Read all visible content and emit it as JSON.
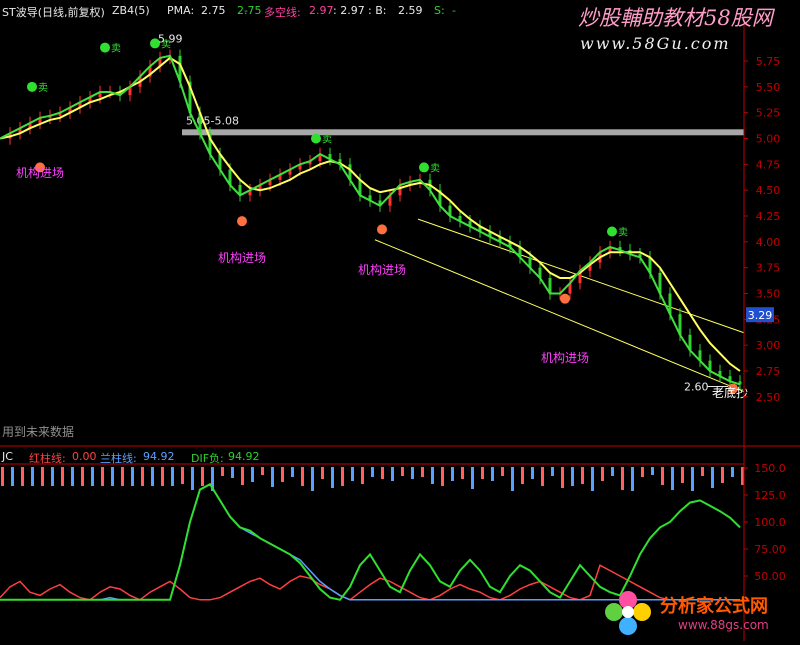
{
  "header": {
    "name": "ST波导(日线,前复权)",
    "indicator": "ZB4(5)",
    "pma_label": "PMA:",
    "pma_value": "2.75",
    "dash": "-",
    "pma2_value": "2.75",
    "multi_label": "多空线:",
    "multi_value": "2.97",
    "colon_value": ": 2.97",
    "b_label": ": B:",
    "b_value": "2.59",
    "s_label": "S:",
    "s_value": "-"
  },
  "sub_header": {
    "name": "JC",
    "red_label": "红柱线:",
    "red_value": "0.00",
    "blue_label": "兰柱线:",
    "blue_value": "94.92",
    "dif_label": "DIF负:",
    "dif_value": "94.92"
  },
  "annotations": {
    "high_price": "5.99",
    "range_label": "5.05-5.08",
    "low_price": "2.60",
    "future_note": "用到未来数据",
    "buy_signal": "机构进场",
    "bottom_signal": "老底抄",
    "sell_mark": "卖",
    "current_price": "3.29"
  },
  "watermark": {
    "title": "炒股輔助教材58股网",
    "url": "www.58Gu.com",
    "logo_title": "分析家公式网",
    "logo_url": "www.88gs.com"
  },
  "colors": {
    "up": "#ff3030",
    "down": "#30d030",
    "ma": "#ffff60",
    "green_line": "#40e040",
    "axis": "#c00000"
  },
  "chart_data": [
    {
      "type": "line",
      "title": "ST波导(日线,前复权)",
      "xlabel": "",
      "ylabel": "",
      "ylim": [
        2.35,
        5.95
      ],
      "y_ticks": [
        "2.50",
        "2.75",
        "3.00",
        "3.25",
        "3.50",
        "3.75",
        "4.00",
        "4.25",
        "4.50",
        "4.75",
        "5.00",
        "5.25",
        "5.50",
        "5.75"
      ],
      "x": [
        0,
        10,
        20,
        30,
        40,
        50,
        60,
        70,
        80,
        90,
        100,
        110,
        120,
        130,
        140,
        150,
        160,
        170,
        180,
        190,
        200,
        210,
        220,
        230,
        240,
        250,
        260,
        270,
        280,
        290,
        300,
        310,
        320,
        330,
        340,
        350,
        360,
        370,
        380,
        390,
        400,
        410,
        420,
        430,
        440,
        450,
        460,
        470,
        480,
        490,
        500,
        510,
        520,
        530,
        540,
        550,
        560,
        570,
        580,
        590,
        600,
        610,
        620,
        630,
        640,
        650,
        660,
        670,
        680,
        690,
        700,
        710,
        720,
        730,
        740
      ],
      "series": [
        {
          "name": "PMA",
          "values": [
            5.0,
            5.05,
            5.1,
            5.15,
            5.2,
            5.22,
            5.25,
            5.3,
            5.35,
            5.4,
            5.45,
            5.45,
            5.42,
            5.5,
            5.6,
            5.7,
            5.78,
            5.8,
            5.55,
            5.25,
            5.05,
            4.85,
            4.7,
            4.55,
            4.45,
            4.5,
            4.55,
            4.6,
            4.65,
            4.7,
            4.75,
            4.78,
            4.85,
            4.8,
            4.75,
            4.6,
            4.45,
            4.4,
            4.35,
            4.45,
            4.55,
            4.58,
            4.6,
            4.5,
            4.35,
            4.25,
            4.2,
            4.15,
            4.1,
            4.05,
            4.0,
            3.95,
            3.85,
            3.75,
            3.65,
            3.5,
            3.5,
            3.6,
            3.72,
            3.8,
            3.9,
            3.95,
            3.92,
            3.88,
            3.85,
            3.7,
            3.5,
            3.3,
            3.1,
            2.95,
            2.85,
            2.75,
            2.7,
            2.65,
            2.62
          ]
        },
        {
          "name": "多空线",
          "values": [
            5.0,
            5.02,
            5.05,
            5.1,
            5.14,
            5.18,
            5.2,
            5.25,
            5.3,
            5.35,
            5.38,
            5.42,
            5.45,
            5.5,
            5.55,
            5.62,
            5.7,
            5.78,
            5.72,
            5.5,
            5.25,
            5.0,
            4.85,
            4.72,
            4.6,
            4.52,
            4.5,
            4.52,
            4.56,
            4.6,
            4.66,
            4.7,
            4.75,
            4.78,
            4.76,
            4.7,
            4.6,
            4.52,
            4.48,
            4.5,
            4.52,
            4.55,
            4.57,
            4.55,
            4.48,
            4.4,
            4.3,
            4.22,
            4.15,
            4.1,
            4.05,
            4.0,
            3.95,
            3.88,
            3.8,
            3.7,
            3.65,
            3.65,
            3.7,
            3.78,
            3.85,
            3.9,
            3.9,
            3.9,
            3.9,
            3.85,
            3.75,
            3.6,
            3.45,
            3.3,
            3.15,
            3.02,
            2.92,
            2.82,
            2.75
          ]
        }
      ],
      "annotations": [
        "5.99",
        "5.05-5.08",
        "2.60",
        "机构进场",
        "老底抄",
        "3.29"
      ]
    },
    {
      "type": "line",
      "title": "JC",
      "xlabel": "",
      "ylabel": "",
      "ylim": [
        25,
        155
      ],
      "y_ticks": [
        "50.00",
        "75.00",
        "100.0",
        "125.0",
        "150.0"
      ],
      "x": [
        0,
        10,
        20,
        30,
        40,
        50,
        60,
        70,
        80,
        90,
        100,
        110,
        120,
        130,
        140,
        150,
        160,
        170,
        180,
        190,
        200,
        210,
        220,
        230,
        240,
        250,
        260,
        270,
        280,
        290,
        300,
        310,
        320,
        330,
        340,
        350,
        360,
        370,
        380,
        390,
        400,
        410,
        420,
        430,
        440,
        450,
        460,
        470,
        480,
        490,
        500,
        510,
        520,
        530,
        540,
        550,
        560,
        570,
        580,
        590,
        600,
        610,
        620,
        630,
        640,
        650,
        660,
        670,
        680,
        690,
        700,
        710,
        720,
        730,
        740
      ],
      "series": [
        {
          "name": "红柱线",
          "values": [
            30,
            40,
            45,
            35,
            32,
            38,
            42,
            35,
            30,
            28,
            35,
            40,
            38,
            32,
            28,
            35,
            40,
            45,
            38,
            30,
            28,
            28,
            30,
            35,
            40,
            45,
            48,
            42,
            38,
            45,
            50,
            48,
            42,
            38,
            32,
            28,
            35,
            42,
            48,
            45,
            40,
            35,
            30,
            28,
            32,
            38,
            42,
            38,
            35,
            30,
            28,
            32,
            38,
            42,
            45,
            40,
            35,
            30,
            28,
            32,
            60,
            55,
            50,
            45,
            40,
            35,
            30,
            28,
            28,
            28,
            28,
            28,
            28,
            28,
            28
          ]
        },
        {
          "name": "兰柱线",
          "values": [
            28,
            28,
            28,
            28,
            28,
            28,
            28,
            28,
            28,
            28,
            28,
            30,
            28,
            28,
            28,
            28,
            28,
            28,
            60,
            100,
            130,
            135,
            120,
            105,
            95,
            90,
            85,
            80,
            75,
            70,
            65,
            55,
            45,
            38,
            32,
            28,
            28,
            28,
            28,
            28,
            28,
            28,
            28,
            28,
            28,
            28,
            28,
            28,
            28,
            28,
            28,
            28,
            28,
            28,
            28,
            28,
            28,
            28,
            28,
            28,
            28,
            28,
            28,
            28,
            28,
            28,
            28,
            28,
            28,
            28,
            28,
            28,
            28,
            28,
            28
          ]
        },
        {
          "name": "DIF负",
          "values": [
            28,
            28,
            28,
            28,
            28,
            28,
            28,
            28,
            28,
            28,
            28,
            28,
            28,
            28,
            28,
            28,
            28,
            28,
            60,
            100,
            130,
            135,
            120,
            105,
            95,
            92,
            85,
            80,
            75,
            70,
            62,
            50,
            38,
            30,
            28,
            40,
            60,
            70,
            55,
            40,
            35,
            55,
            70,
            60,
            45,
            40,
            55,
            65,
            55,
            40,
            35,
            50,
            60,
            55,
            45,
            35,
            30,
            45,
            60,
            50,
            40,
            35,
            32,
            50,
            70,
            85,
            95,
            100,
            110,
            118,
            120,
            115,
            110,
            104,
            95
          ]
        }
      ]
    }
  ]
}
